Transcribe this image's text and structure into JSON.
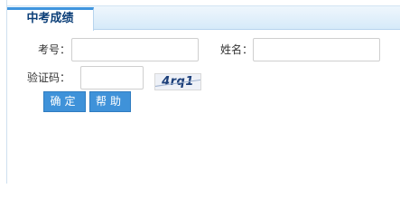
{
  "tab": {
    "title": "中考成绩"
  },
  "form": {
    "exam_number_label": "考号：",
    "exam_number_value": "",
    "name_label": "姓名：",
    "name_value": "",
    "captcha_label": "验证码：",
    "captcha_value": "",
    "captcha_image_text": "4rq1"
  },
  "buttons": {
    "confirm_label": "确定",
    "help_label": "帮助"
  }
}
